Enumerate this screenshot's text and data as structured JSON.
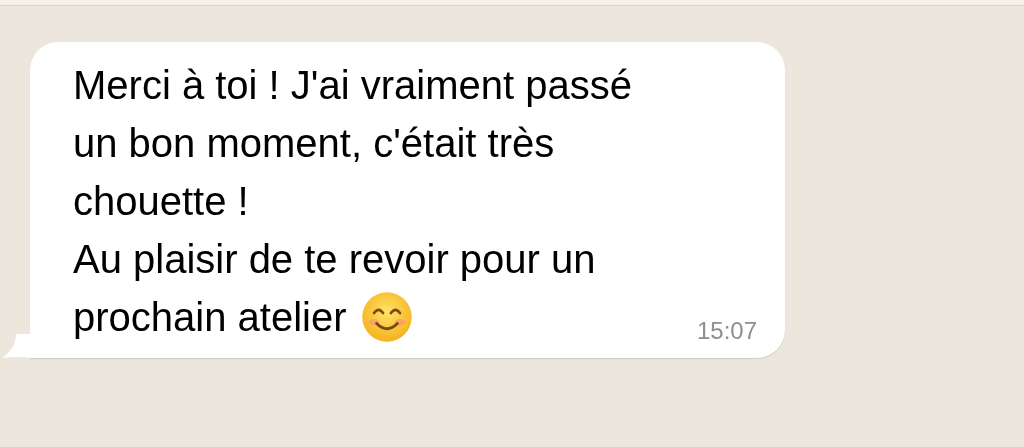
{
  "message": {
    "lines": [
      "Merci à toi ! J'ai vraiment passé",
      "un bon moment, c'était très",
      "chouette !",
      "Au plaisir de te revoir pour un",
      "prochain atelier"
    ],
    "time": "15:07"
  }
}
